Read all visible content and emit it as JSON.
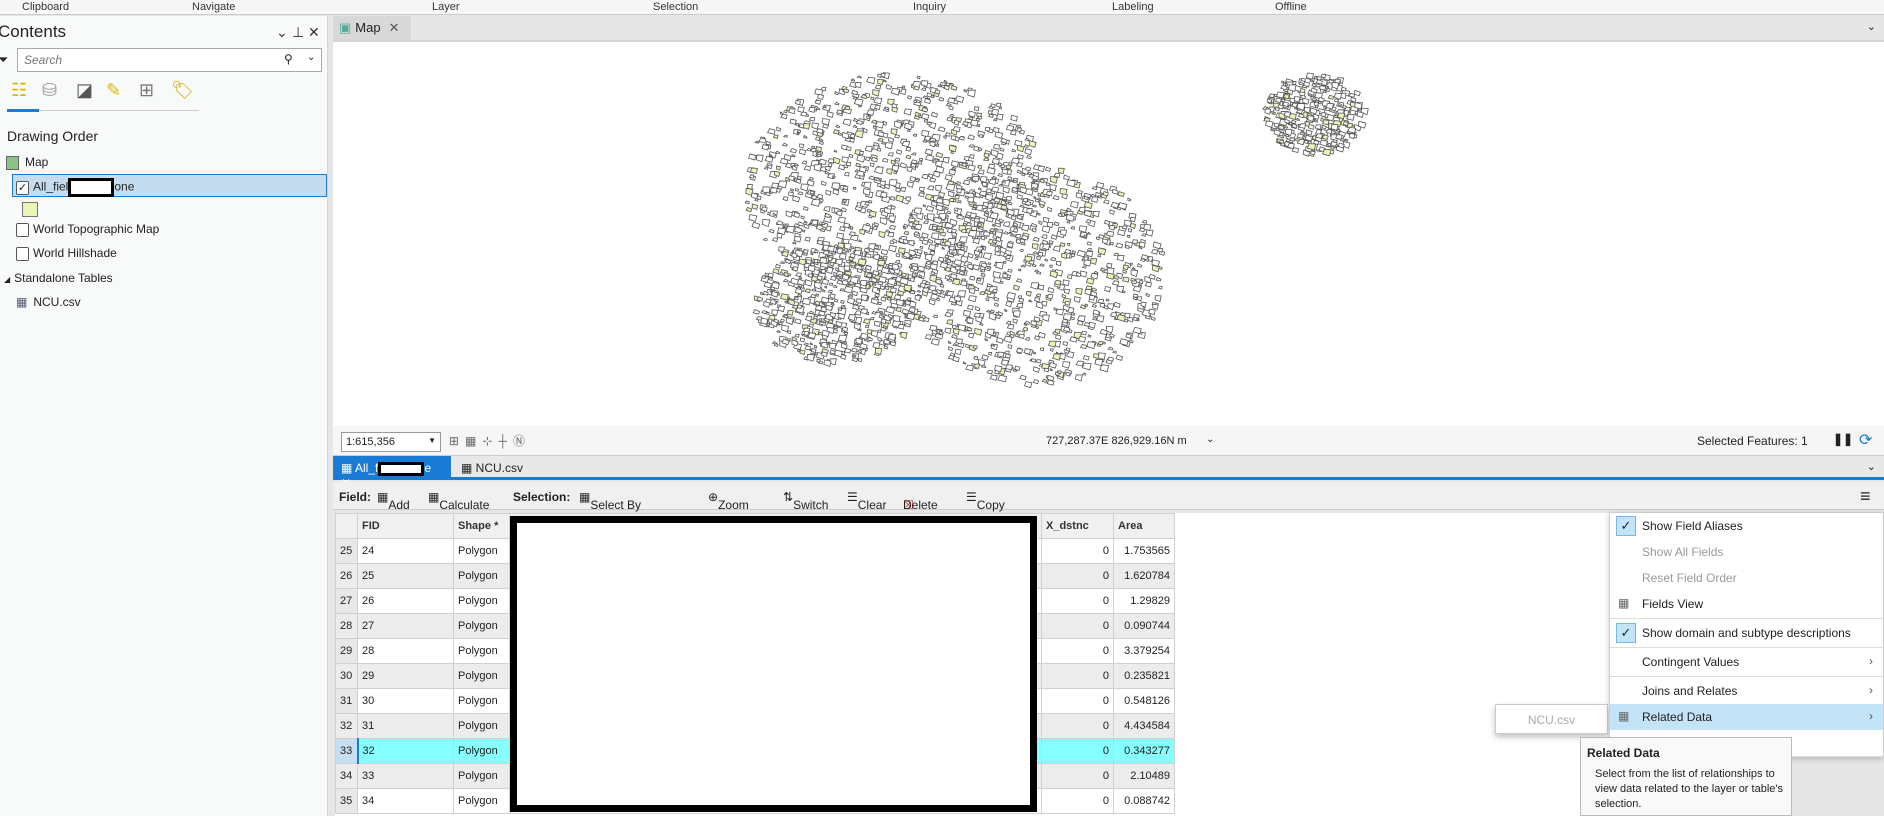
{
  "ribbon": {
    "groups": [
      "Clipboard",
      "Navigate",
      "Layer",
      "Selection",
      "Inquiry",
      "Labeling",
      "Offline"
    ]
  },
  "contents": {
    "title": "Contents",
    "search_placeholder": "Search",
    "section": "Drawing Order",
    "map": "Map",
    "layer": "All_fiel",
    "layer_suffix": "one",
    "topo": "World Topographic Map",
    "hillshade": "World Hillshade",
    "standalone": "Standalone Tables",
    "table": "NCU.csv",
    "symbol_color": "#eaf5b8"
  },
  "map": {
    "tab": "Map",
    "scale": "1:615,356",
    "coords": "727,287.37E 826,929.16N m",
    "selected": "Selected Features: 1",
    "fill": "#eaf5b8",
    "stroke": "#555555"
  },
  "table_tabs": [
    {
      "label": "All_f",
      "suffix": "e"
    },
    {
      "label": "NCU.csv"
    }
  ],
  "toolbar": {
    "field": "Field:",
    "add": "Add",
    "calculate": "Calculate",
    "selection": "Selection:",
    "select_by_attr": "Select By Attributes",
    "zoom_to": "Zoom To",
    "switch": "Switch",
    "clear": "Clear",
    "delete": "Delete",
    "copy": "Copy"
  },
  "grid": {
    "headers": [
      "FID",
      "Shape *",
      "X_dstnc",
      "Area"
    ],
    "rows": [
      [
        "25",
        "24",
        "Polygon",
        "0",
        "1.753565"
      ],
      [
        "26",
        "25",
        "Polygon",
        "0",
        "1.620784"
      ],
      [
        "27",
        "26",
        "Polygon",
        "0",
        "1.29829"
      ],
      [
        "28",
        "27",
        "Polygon",
        "0",
        "0.090744"
      ],
      [
        "29",
        "28",
        "Polygon",
        "0",
        "3.379254"
      ],
      [
        "30",
        "29",
        "Polygon",
        "0",
        "0.235821"
      ],
      [
        "31",
        "30",
        "Polygon",
        "0",
        "0.548126"
      ],
      [
        "32",
        "31",
        "Polygon",
        "0",
        "4.434584"
      ],
      [
        "33",
        "32",
        "Polygon",
        "0",
        "0.343277"
      ],
      [
        "34",
        "33",
        "Polygon",
        "0",
        "2.10489"
      ],
      [
        "35",
        "34",
        "Polygon",
        "0",
        "0.088742"
      ]
    ],
    "selected_row": 8
  },
  "menu": {
    "items": [
      "Show Field Aliases",
      "Show All Fields",
      "Reset Field Order",
      "Fields View",
      "Show domain and subtype descriptions",
      "Contingent Values",
      "Joins and Relates",
      "Related Data"
    ]
  },
  "submenu": {
    "item": "NCU.csv"
  },
  "tooltip": {
    "title": "Related Data",
    "body": "Select from the list of relationships to view data related to the layer or table's selection."
  }
}
